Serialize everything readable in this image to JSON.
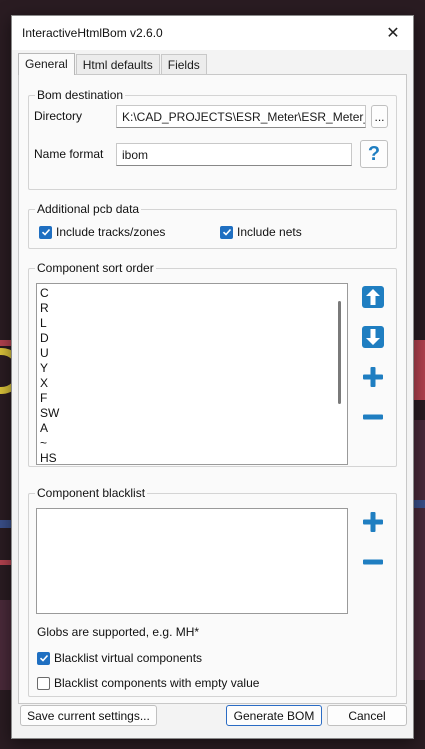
{
  "window": {
    "title": "InteractiveHtmlBom v2.6.0",
    "close_glyph": "✕"
  },
  "tabs": [
    {
      "label": "General",
      "active": true
    },
    {
      "label": "Html defaults",
      "active": false
    },
    {
      "label": "Fields",
      "active": false
    }
  ],
  "bom_destination": {
    "group_title": "Bom destination",
    "directory_label": "Directory",
    "directory_value": "K:\\CAD_PROJECTS\\ESR_Meter\\ESR_Meter_Pan",
    "browse_label": "...",
    "name_format_label": "Name format",
    "name_format_value": "ibom",
    "help_label": "?"
  },
  "additional_pcb": {
    "group_title": "Additional pcb data",
    "include_tracks_label": "Include tracks/zones",
    "include_tracks_checked": true,
    "include_nets_label": "Include nets",
    "include_nets_checked": true
  },
  "sort_order": {
    "group_title": "Component sort order",
    "items": [
      "C",
      "R",
      "L",
      "D",
      "U",
      "Y",
      "X",
      "F",
      "SW",
      "A",
      "~",
      "HS"
    ],
    "icons": [
      "arrow-up-icon",
      "arrow-down-icon",
      "plus-icon",
      "minus-icon"
    ]
  },
  "blacklist": {
    "group_title": "Component blacklist",
    "items": [],
    "globs_text": "Globs are supported, e.g. MH*",
    "virtual_label": "Blacklist virtual components",
    "virtual_checked": true,
    "empty_value_label": "Blacklist components with empty value",
    "empty_value_checked": false,
    "icons": [
      "plus-icon",
      "minus-icon"
    ]
  },
  "footer": {
    "save_label": "Save current settings...",
    "generate_label": "Generate BOM",
    "cancel_label": "Cancel"
  },
  "colors": {
    "accent": "#1f7ec1",
    "checkbox": "#1f6fc1"
  }
}
